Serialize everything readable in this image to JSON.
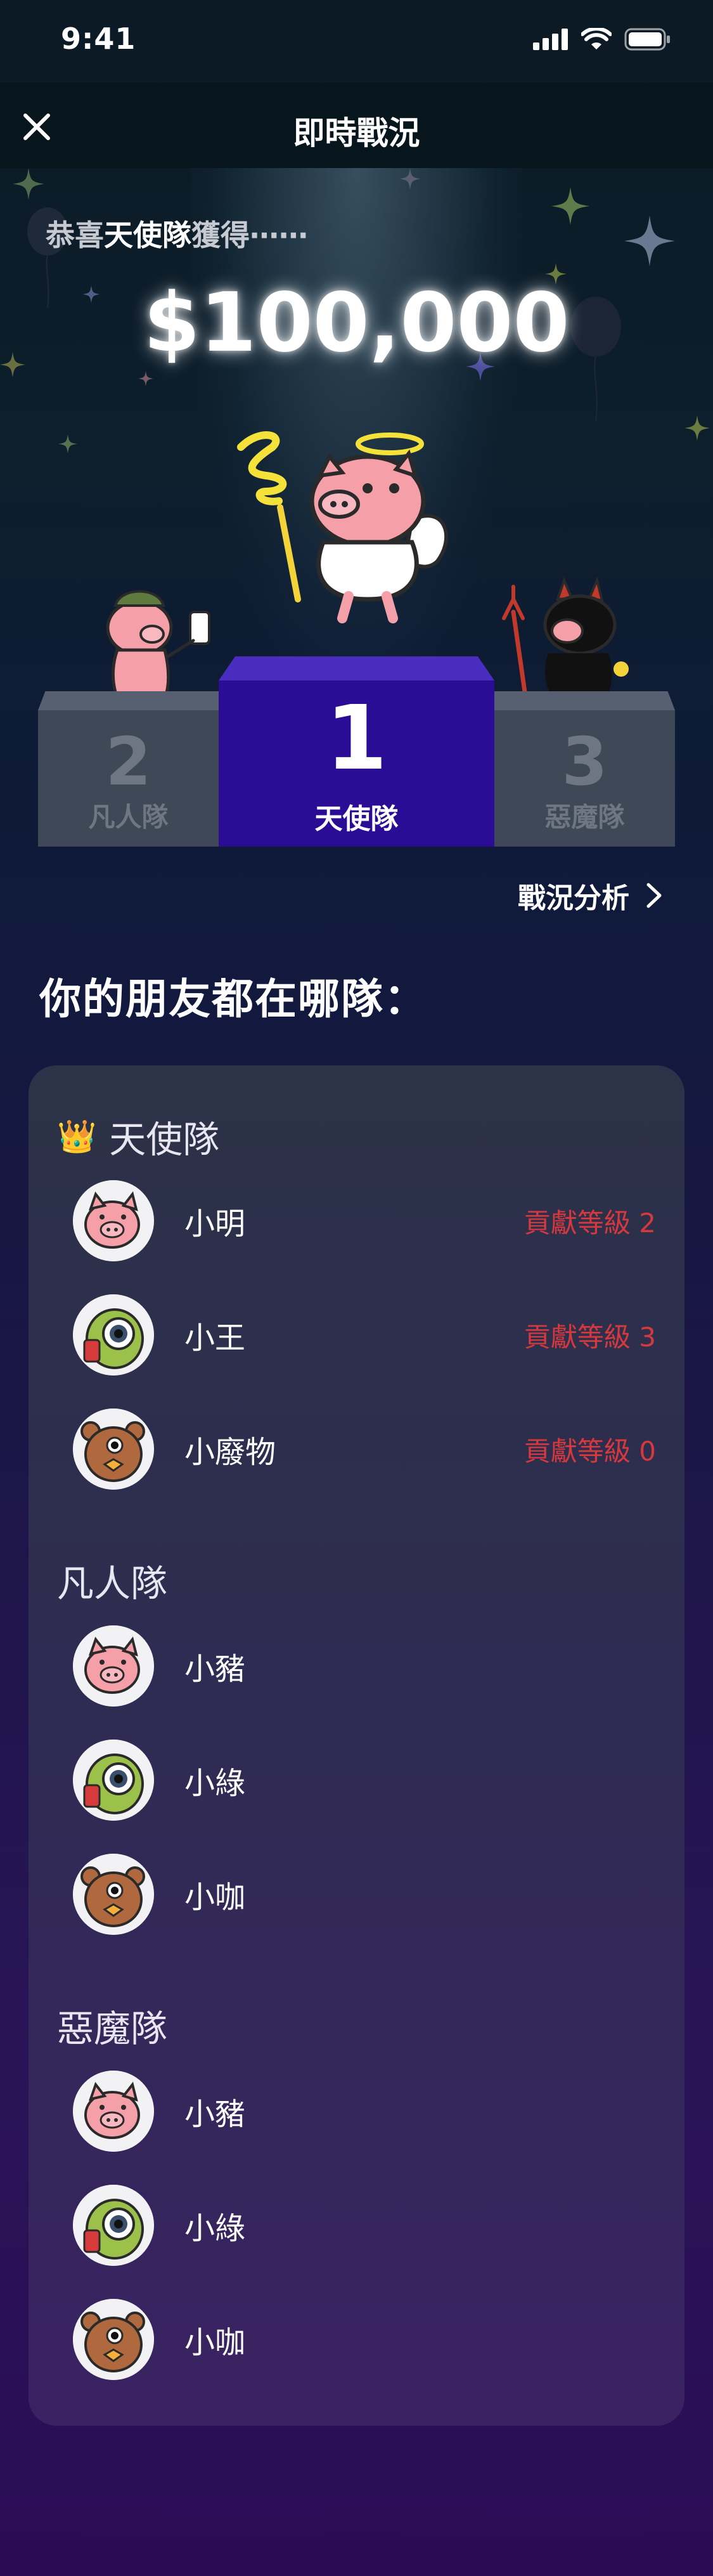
{
  "status_bar": {
    "time": "9:41"
  },
  "nav": {
    "title": "即時戰況"
  },
  "hero": {
    "congrats_prefix": "恭喜",
    "congrats_team": "天使隊",
    "congrats_suffix": "獲得⋯⋯",
    "prize": "$100,000"
  },
  "podium": [
    {
      "rank": "2",
      "team": "凡人隊"
    },
    {
      "rank": "1",
      "team": "天使隊"
    },
    {
      "rank": "3",
      "team": "惡魔隊"
    }
  ],
  "analysis_link": "戰況分析",
  "friends_title": "你的朋友都在哪隊：",
  "teams": [
    {
      "name": "天使隊",
      "crown": "👑",
      "members": [
        {
          "name": "小明",
          "avatar": "pig-avatar",
          "level": "貢獻等級 2"
        },
        {
          "name": "小王",
          "avatar": "green-monster-avatar",
          "level": "貢獻等級 3"
        },
        {
          "name": "小廢物",
          "avatar": "bear-avatar",
          "level": "貢獻等級 0"
        }
      ]
    },
    {
      "name": "凡人隊",
      "members": [
        {
          "name": "小豬",
          "avatar": "pig-avatar"
        },
        {
          "name": "小綠",
          "avatar": "green-monster-avatar"
        },
        {
          "name": "小咖",
          "avatar": "bear-avatar"
        }
      ]
    },
    {
      "name": "惡魔隊",
      "members": [
        {
          "name": "小豬",
          "avatar": "pig-avatar"
        },
        {
          "name": "小綠",
          "avatar": "green-monster-avatar"
        },
        {
          "name": "小咖",
          "avatar": "bear-avatar"
        }
      ]
    }
  ],
  "colors": {
    "podium_first": "#2a0d94",
    "podium_side": "#3e4856",
    "level_text": "#d6393d",
    "nav_bg": "#07161c"
  }
}
